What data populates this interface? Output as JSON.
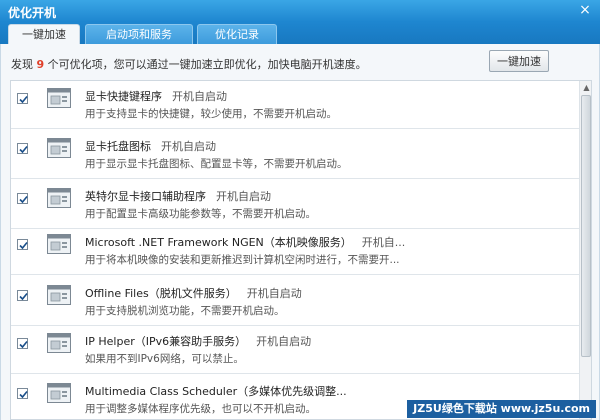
{
  "window": {
    "title": "优化开机",
    "close_glyph": "×"
  },
  "tabs": [
    {
      "label": "一键加速"
    },
    {
      "label": "启动项和服务"
    },
    {
      "label": "优化记录"
    }
  ],
  "header": {
    "prefix": "发现 ",
    "count": "9",
    "suffix": " 个可优化项，您可以通过一键加速立即优化，加快电脑开机速度。",
    "button_label": "一键加速"
  },
  "items": [
    {
      "name": "显卡快捷键程序",
      "status": "开机自启动",
      "desc": "用于支持显卡的快捷键，较少使用，不需要开机启动。",
      "checked": true
    },
    {
      "name": "显卡托盘图标",
      "status": "开机自启动",
      "desc": "用于显示显卡托盘图标、配置显卡等，不需要开机启动。",
      "checked": true
    },
    {
      "name": "英特尔显卡接口辅助程序",
      "status": "开机自启动",
      "desc": "用于配置显卡高级功能参数等，不需要开机启动。",
      "checked": true
    },
    {
      "name": "Microsoft .NET Framework NGEN（本机映像服务）",
      "status": "开机自...",
      "desc": "用于将本机映像的安装和更新推迟到计算机空闲时进行，不需要开...",
      "checked": true
    },
    {
      "name": "Offline Files（脱机文件服务）",
      "status": "开机自启动",
      "desc": "用于支持脱机浏览功能，不需要开机启动。",
      "checked": true
    },
    {
      "name": "IP Helper（IPv6兼容助手服务）",
      "status": "开机自启动",
      "desc": "如果用不到IPv6网络，可以禁止。",
      "checked": true
    },
    {
      "name": "Multimedia Class Scheduler（多媒体优先级调整...",
      "status": "",
      "desc": "用于调整多媒体程序优先级，也可以不开机启动。",
      "checked": true
    }
  ],
  "watermark": "JZ5U绿色下载站 www.jz5u.com",
  "colors": {
    "titlebar": "#1e86d0",
    "accent_count": "#e0402a",
    "watermark_bg": "#1c5fa0"
  }
}
